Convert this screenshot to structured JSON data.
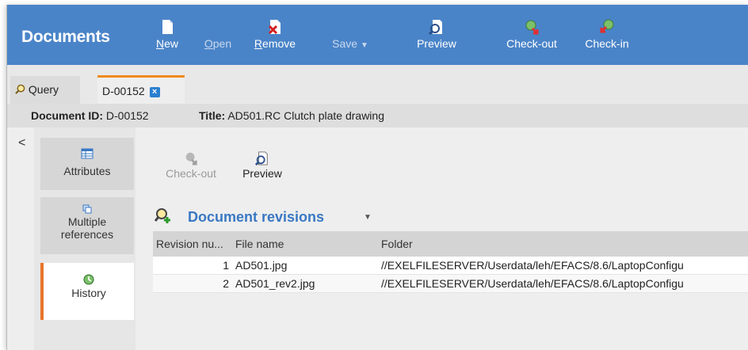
{
  "app": {
    "title": "Documents"
  },
  "toolbar": {
    "new": "New",
    "open": "Open",
    "remove": "Remove",
    "save": "Save",
    "save_arrow": "▼",
    "preview": "Preview",
    "checkout": "Check-out",
    "checkin": "Check-in"
  },
  "tabs": [
    {
      "label": "Query",
      "icon": "magnifier-icon"
    },
    {
      "label": "D-00152",
      "icon": "close-icon",
      "close": "×"
    }
  ],
  "info": {
    "doc_id_label": "Document ID:",
    "doc_id": "D-00152",
    "title_label": "Title:",
    "title": "AD501.RC Clutch plate drawing"
  },
  "sidebar": {
    "collapse": "<",
    "items": [
      {
        "label": "Attributes",
        "icon": "table-icon"
      },
      {
        "label": "Multiple references",
        "line1": "Multiple",
        "line2": "references",
        "icon": "copy-icon"
      },
      {
        "label": "History",
        "icon": "history-icon"
      }
    ]
  },
  "actions": {
    "checkout": "Check-out",
    "preview": "Preview"
  },
  "revisions": {
    "title": "Document revisions",
    "dropdown": "▼",
    "columns": [
      "Revision nu...",
      "File name",
      "Folder"
    ],
    "rows": [
      {
        "rev": "1",
        "file": "AD501.jpg",
        "folder": "//EXELFILESERVER/Userdata/leh/EFACS/8.6/LaptopConfigu"
      },
      {
        "rev": "2",
        "file": "AD501_rev2.jpg",
        "folder": "//EXELFILESERVER/Userdata/leh/EFACS/8.6/LaptopConfigu"
      }
    ]
  },
  "colors": {
    "toolbar": "#4a84c8",
    "accent": "#f08a1c",
    "link": "#3a78c3"
  }
}
